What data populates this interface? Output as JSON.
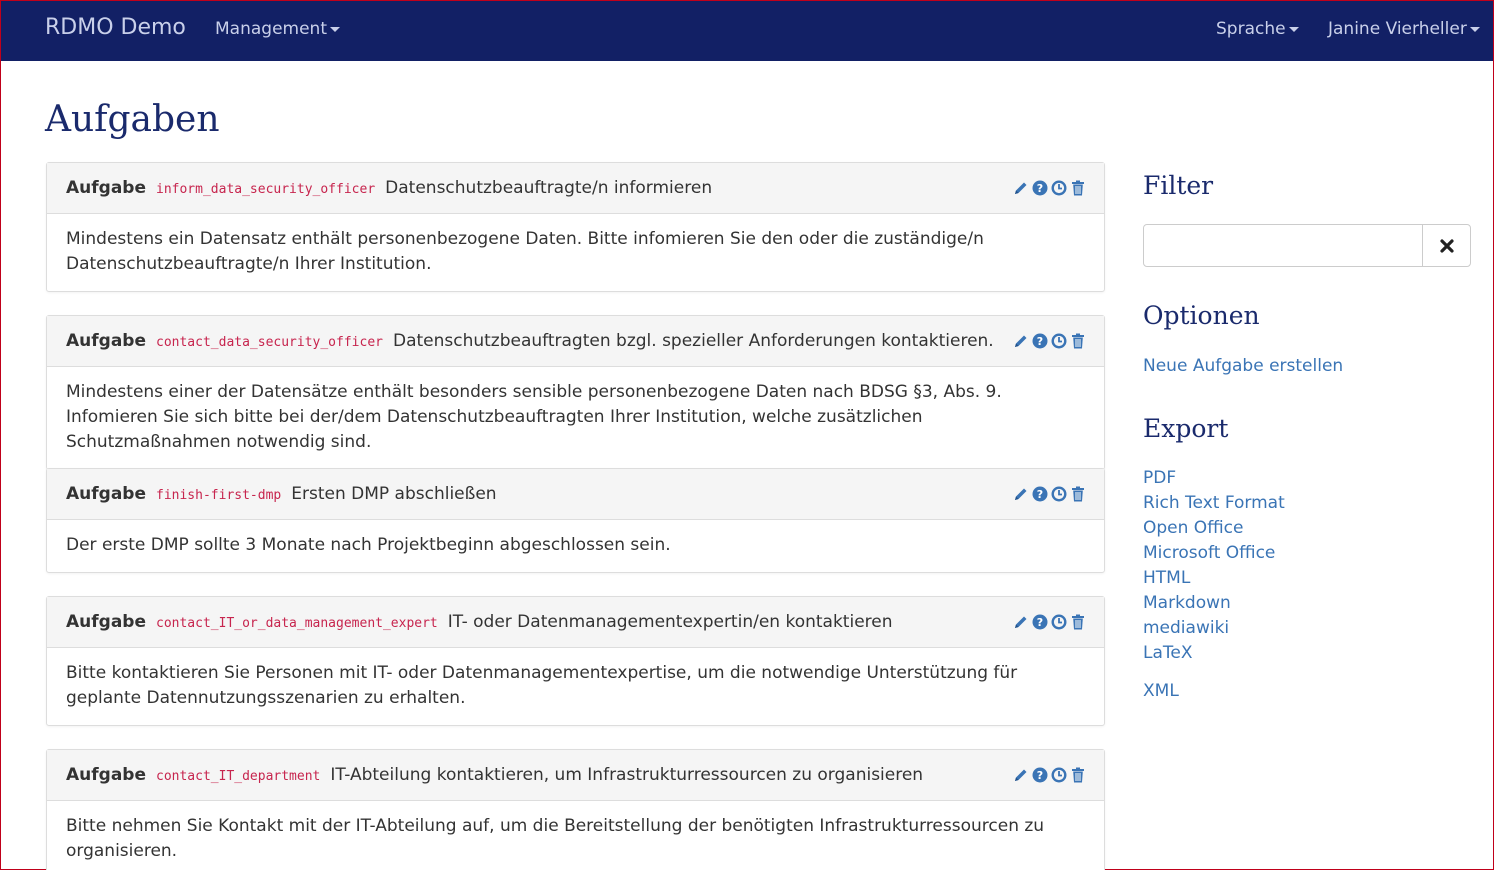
{
  "navbar": {
    "brand": "RDMO Demo",
    "management": "Management",
    "language": "Sprache",
    "user": "Janine Vierheller"
  },
  "page": {
    "title": "Aufgaben"
  },
  "tasks": [
    {
      "label": "Aufgabe",
      "key": "inform_data_security_officer",
      "title": "Datenschutzbeauftragte/n informieren",
      "body": "Mindestens ein Datensatz enthält personenbezogene Daten. Bitte infomieren Sie den oder die zuständige/n Datenschutzbeauftragte/n Ihrer Institution."
    },
    {
      "label": "Aufgabe",
      "key": "contact_data_security_officer",
      "title": "Datenschutzbeauftragten bzgl. spezieller Anforderungen kontaktieren.",
      "body": "Mindestens einer der Datensätze enthält besonders sensible personenbezogene Daten nach BDSG §3, Abs. 9. Infomieren Sie sich bitte bei der/dem Datenschutzbeauftragten Ihrer Institution, welche zusätzlichen Schutzmaßnahmen notwendig sind."
    },
    {
      "label": "Aufgabe",
      "key": "finish-first-dmp",
      "title": "Ersten DMP abschließen",
      "body": "Der erste DMP sollte 3 Monate nach Projektbeginn abgeschlossen sein."
    },
    {
      "label": "Aufgabe",
      "key": "contact_IT_or_data_management_expert",
      "title": "IT- oder Datenmanagementexpertin/en kontaktieren",
      "body": "Bitte kontaktieren Sie Personen mit IT- oder Datenmanagementexpertise, um die notwendige Unterstützung für geplante Datennutzungsszenarien zu erhalten."
    },
    {
      "label": "Aufgabe",
      "key": "contact_IT_department",
      "title": "IT-Abteilung kontaktieren, um Infrastrukturressourcen zu organisieren",
      "body": "Bitte nehmen Sie Kontakt mit der IT-Abteilung auf, um die Bereitstellung der benötigten Infrastrukturressourcen zu organisieren."
    }
  ],
  "task_icons": [
    "pencil-icon",
    "question-circle-icon",
    "clock-icon",
    "trash-icon"
  ],
  "sidebar": {
    "filter_heading": "Filter",
    "filter_value": "",
    "options_heading": "Optionen",
    "new_task": "Neue Aufgabe erstellen",
    "export_heading": "Export",
    "export_links": [
      "PDF",
      "Rich Text Format",
      "Open Office",
      "Microsoft Office",
      "HTML",
      "Markdown",
      "mediawiki",
      "LaTeX"
    ],
    "xml": "XML"
  },
  "colors": {
    "navbar": "#122065",
    "heading": "#1a2a6c",
    "link": "#3a74b5",
    "code": "#c7254e",
    "icon": "#3a74b5"
  }
}
